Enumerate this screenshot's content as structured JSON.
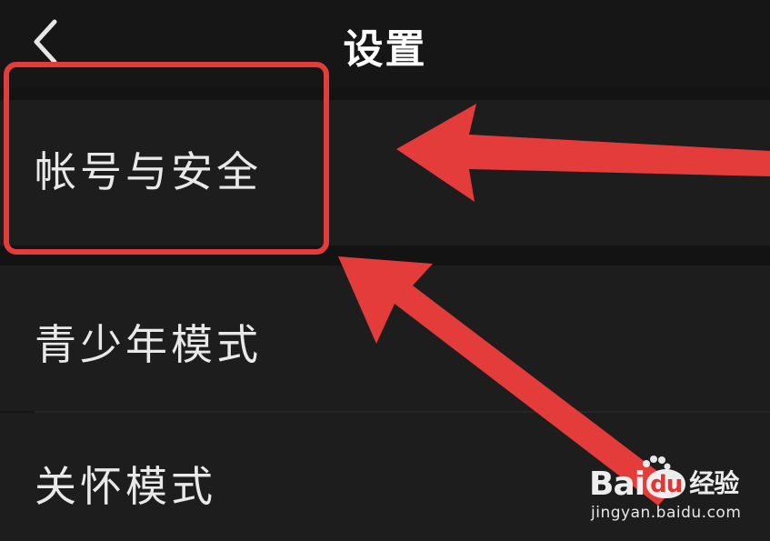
{
  "navbar": {
    "title": "设置",
    "back_icon": "chevron-left-icon"
  },
  "settings": {
    "items": [
      {
        "label": "帐号与安全",
        "highlighted": true
      },
      {
        "label": "青少年模式",
        "highlighted": false
      },
      {
        "label": "关怀模式",
        "highlighted": false
      }
    ]
  },
  "annotation": {
    "highlight_color": "#e43b3b"
  },
  "watermark": {
    "brand_bai": "Bai",
    "brand_du": "du",
    "brand_jingyan": "经验",
    "url": "jingyan.baidu.com"
  },
  "colors": {
    "background": "#161616",
    "row": "#1d1d1d",
    "text": "#e9e9e9",
    "title": "#ffffff"
  }
}
